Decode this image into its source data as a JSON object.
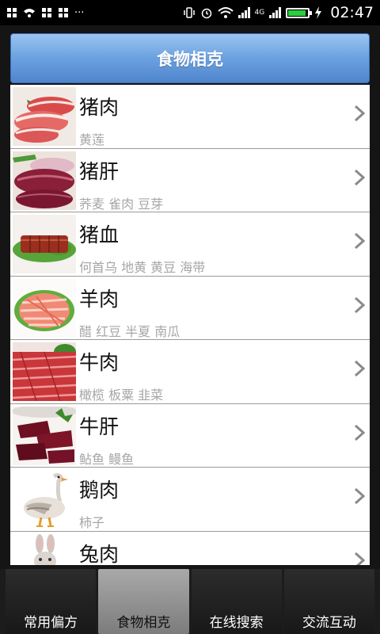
{
  "status_bar": {
    "time": "02:47",
    "network": "4G"
  },
  "header": {
    "title": "食物相克"
  },
  "list": [
    {
      "name": "猪肉",
      "sub": "黄莲",
      "thumb": "pork-photo"
    },
    {
      "name": "猪肝",
      "sub": "荞麦 雀肉 豆芽",
      "thumb": "pork-liver-photo"
    },
    {
      "name": "猪血",
      "sub": "何首乌 地黄 黄豆 海带",
      "thumb": "pig-blood-photo"
    },
    {
      "name": "羊肉",
      "sub": "醋 红豆 半夏 南瓜",
      "thumb": "mutton-photo"
    },
    {
      "name": "牛肉",
      "sub": "橄榄 板粟 韭菜",
      "thumb": "beef-photo"
    },
    {
      "name": "牛肝",
      "sub": "鲇鱼 鳗鱼",
      "thumb": "beef-liver-photo"
    },
    {
      "name": "鹅肉",
      "sub": "柿子",
      "thumb": "goose-photo"
    },
    {
      "name": "兔肉",
      "sub": "",
      "thumb": "rabbit-photo"
    }
  ],
  "tabs": [
    {
      "label": "常用偏方",
      "active": false
    },
    {
      "label": "食物相克",
      "active": true
    },
    {
      "label": "在线搜索",
      "active": false
    },
    {
      "label": "交流互动",
      "active": false
    }
  ],
  "colors": {
    "title_bar": "#6fa4e2",
    "active_tab": "#a9a9a9",
    "sub_text": "#a6a6a6"
  }
}
